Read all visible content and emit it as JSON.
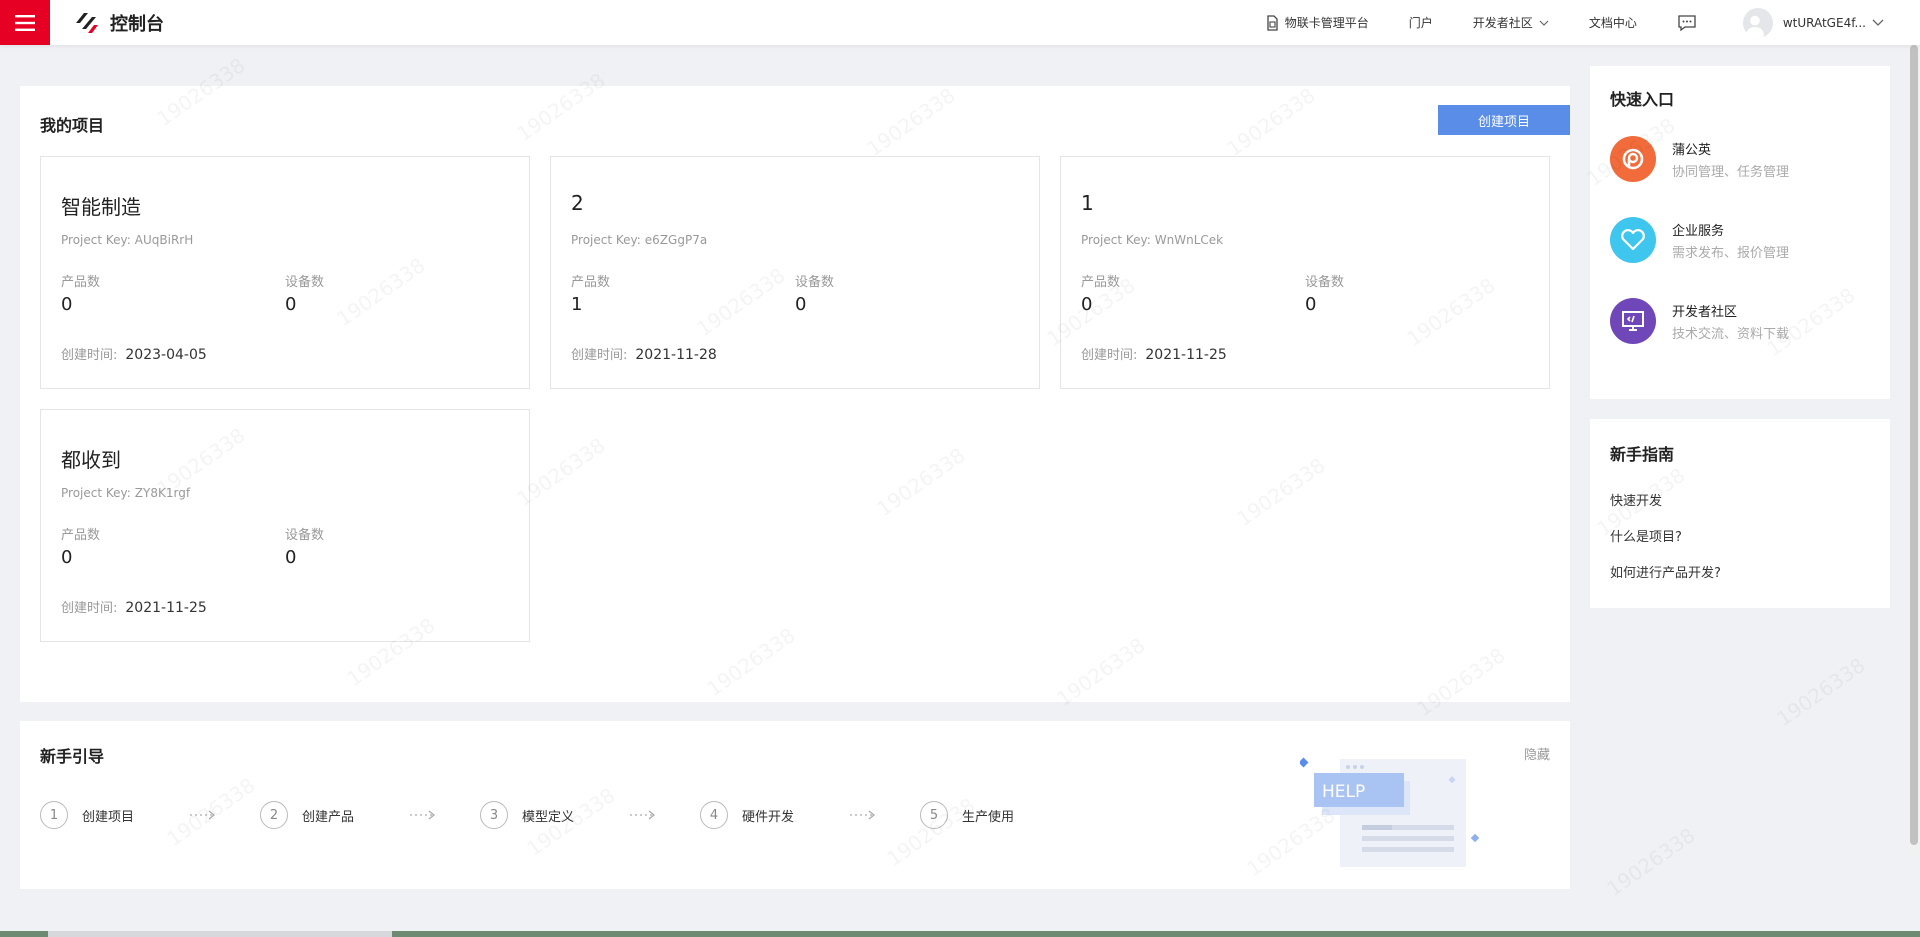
{
  "header": {
    "title": "控制台",
    "nav": [
      {
        "label": "物联卡管理平台",
        "icon": "sim-card-icon"
      },
      {
        "label": "门户"
      },
      {
        "label": "开发者社区",
        "dropdown": true
      },
      {
        "label": "文档中心"
      }
    ],
    "username": "wtURAtGE4f..."
  },
  "projects": {
    "title": "我的项目",
    "create_label": "创建项目",
    "key_label": "Project Key:",
    "products_label": "产品数",
    "devices_label": "设备数",
    "created_label": "创建时间:",
    "items": [
      {
        "name": "智能制造",
        "key": "AUqBiRrH",
        "products": "0",
        "devices": "0",
        "created": "2023-04-05"
      },
      {
        "name": "2",
        "key": "e6ZGgP7a",
        "products": "1",
        "devices": "0",
        "created": "2021-11-28"
      },
      {
        "name": "1",
        "key": "WnWnLCek",
        "products": "0",
        "devices": "0",
        "created": "2021-11-25"
      },
      {
        "name": "都收到",
        "key": "ZY8K1rgf",
        "products": "0",
        "devices": "0",
        "created": "2021-11-25"
      }
    ]
  },
  "guide": {
    "title": "新手引导",
    "hide_label": "隐藏",
    "help_text": "HELP",
    "steps": [
      {
        "num": "1",
        "label": "创建项目"
      },
      {
        "num": "2",
        "label": "创建产品"
      },
      {
        "num": "3",
        "label": "模型定义"
      },
      {
        "num": "4",
        "label": "硬件开发"
      },
      {
        "num": "5",
        "label": "生产使用"
      }
    ]
  },
  "quick": {
    "title": "快速入口",
    "items": [
      {
        "name": "蒲公英",
        "desc": "协同管理、任务管理",
        "color": "#f26b3a",
        "icon": "dandelion-icon"
      },
      {
        "name": "企业服务",
        "desc": "需求发布、报价管理",
        "color": "#3ec6ef",
        "icon": "heart-icon"
      },
      {
        "name": "开发者社区",
        "desc": "技术交流、资料下载",
        "color": "#7047b8",
        "icon": "monitor-icon"
      }
    ]
  },
  "newbie": {
    "title": "新手指南",
    "links": [
      "快速开发",
      "什么是项目?",
      "如何进行产品开发?"
    ]
  },
  "colors": {
    "brand_red": "#e60023",
    "primary_blue": "#5a8de8"
  },
  "watermark": "19026338"
}
